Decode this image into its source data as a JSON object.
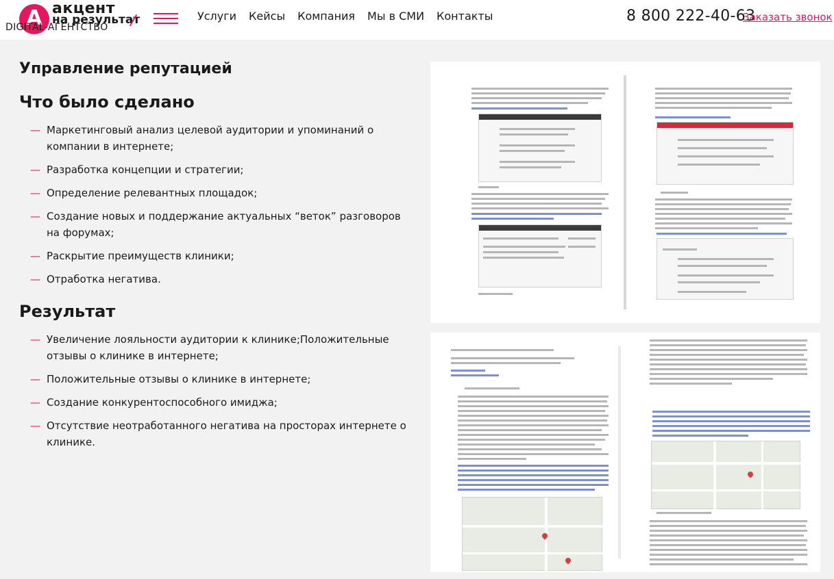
{
  "header": {
    "logo_letter": "A",
    "logo_line1": "акцент",
    "logo_line2": "на результат",
    "tagline": "DIGITAL-АГЕНТСТВО",
    "nav": [
      "Услуги",
      "Кейсы",
      "Компания",
      "Мы в СМИ",
      "Контакты"
    ],
    "phone": "8 800 222-40-63",
    "callback": "Заказать звонок"
  },
  "main": {
    "title": "Управление репутацией",
    "done_heading": "Что было сделано",
    "done_items": [
      "Маркетинговый анализ целевой аудитории и упоминаний о компании в интернете;",
      "Разработка концепции и стратегии;",
      "Определение релевантных площадок;",
      "Создание новых и поддержание актуальных “веток” разговоров на форумах;",
      "Раскрытие преимуществ клиники;",
      "Отработка негатива."
    ],
    "result_heading": "Результат",
    "result_items": [
      "Увеличение лояльности аудитории к клинике;Положительные отзывы о клинике в интернете;",
      "Положительные отзывы о клинике в интернете;",
      "Создание конкурентоспособного имиджа;",
      "Отсутствие неотработанного негатива на просторах интернете о клинике."
    ]
  },
  "colors": {
    "accent": "#e5175e",
    "background": "#f2f2f2"
  },
  "icons": [
    "menu-icon",
    "logo-icon"
  ]
}
